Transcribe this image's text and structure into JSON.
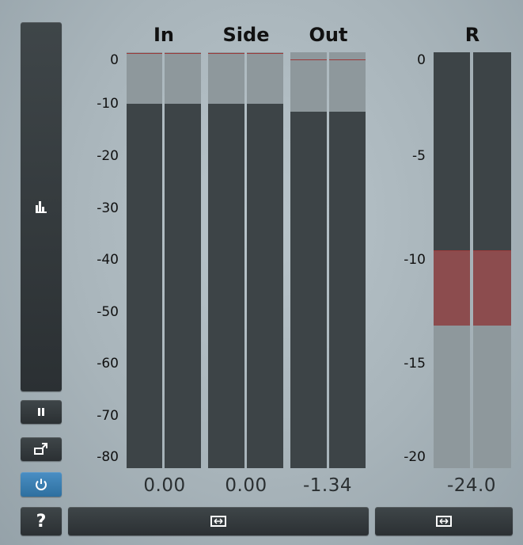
{
  "meters": {
    "headers": [
      "In",
      "Side",
      "Out",
      "R"
    ],
    "left_scale": [
      "0",
      "-10",
      "-20",
      "-30",
      "-40",
      "-50",
      "-60",
      "-70",
      "-80"
    ],
    "right_scale": [
      "0",
      "-5",
      "-10",
      "-15",
      "-20"
    ],
    "readouts": {
      "in": "0.00",
      "side": "0.00",
      "out": "-1.34",
      "r": "-24.0"
    },
    "levels_db": {
      "in": [
        -9.9,
        -9.9
      ],
      "side": [
        -9.9,
        -9.9
      ],
      "out": [
        -11.5,
        -11.5
      ],
      "in_peak": [
        -0.1,
        -0.1
      ],
      "side_peak": [
        -0.1,
        -0.1
      ],
      "out_peak": [
        -1.34,
        -1.34
      ],
      "r_top_db": -10,
      "r_bottom_db": -13.8
    },
    "colors": {
      "bar": "#3d4447",
      "meter_bg": "#8e989c",
      "peak_line": "#9b3a3a",
      "r_highlight": "#8c4c4e"
    }
  },
  "controls": {
    "icons": [
      "histogram-icon",
      "pause-icon",
      "popout-icon",
      "power-icon",
      "help-icon",
      "expand-icon",
      "expand-icon"
    ],
    "help_label": "?"
  }
}
